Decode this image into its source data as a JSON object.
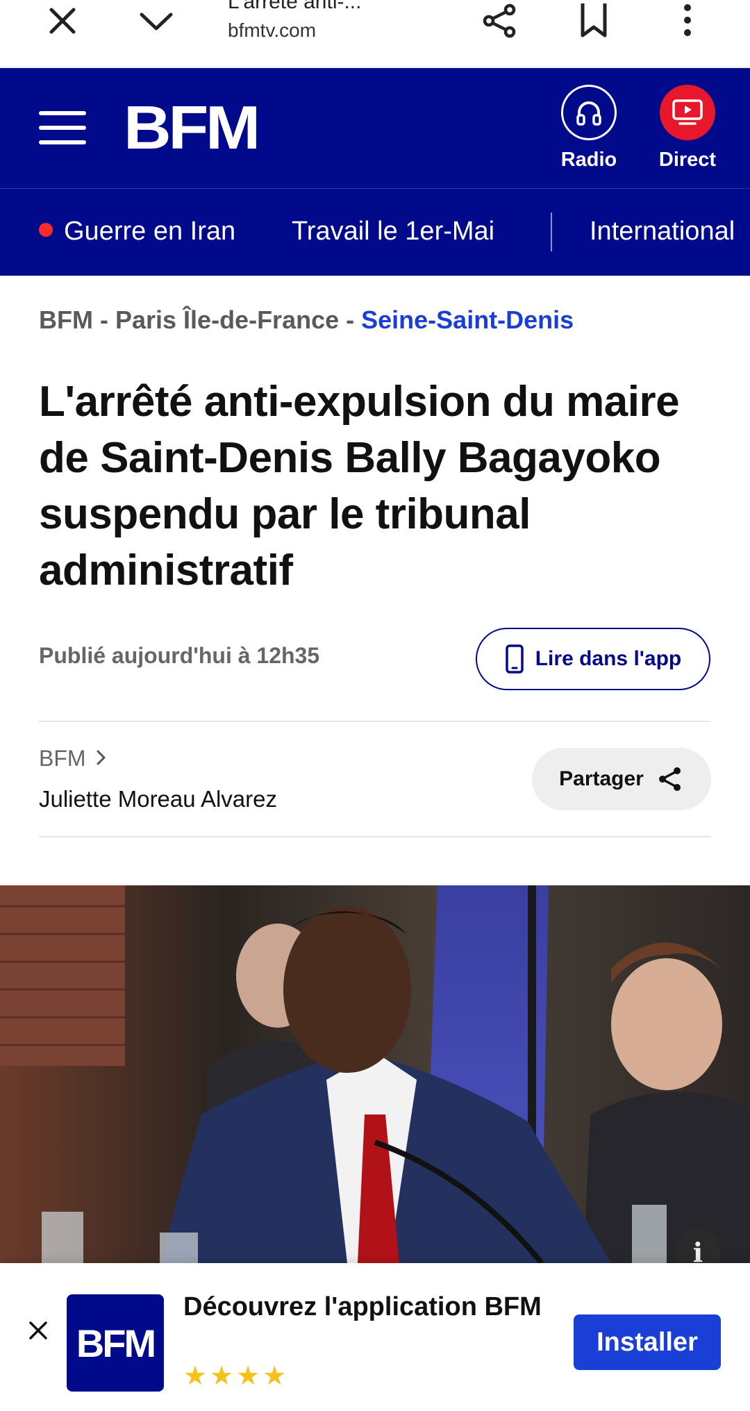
{
  "browser": {
    "tab_title": "L'arrêté anti-...",
    "url": "bfmtv.com",
    "icons": [
      "close-icon",
      "chevron-down-icon",
      "share-icon",
      "bookmark-icon",
      "more-vert-icon"
    ]
  },
  "header": {
    "logo": "BFM",
    "radio_label": "Radio",
    "direct_label": "Direct",
    "colors": {
      "brand": "#000a8a",
      "direct": "#e8182c"
    }
  },
  "nav": {
    "items": [
      {
        "label": "Guerre en Iran",
        "live": true
      },
      {
        "label": "Travail le 1er-Mai"
      },
      {
        "label": "International"
      }
    ]
  },
  "breadcrumb": {
    "items": [
      "BFM",
      "Paris Île-de-France",
      "Seine-Saint-Denis"
    ],
    "separator": "-"
  },
  "article": {
    "headline": "L'arrêté anti-expulsion du maire de Saint-Denis Bally Bagayoko suspendu par le tribunal administratif",
    "published": "Publié aujourd'hui à 12h35",
    "read_in_app_label": "Lire dans l'app",
    "source": "BFM",
    "author": "Juliette Moreau Alvarez",
    "share_label": "Partager"
  },
  "app_banner": {
    "logo": "BFM",
    "title": "Découvrez l'application BFM",
    "stars": "★★★★",
    "install_label": "Installer",
    "colors": {
      "install": "#1a3fd6",
      "stars": "#f5c21b"
    }
  }
}
